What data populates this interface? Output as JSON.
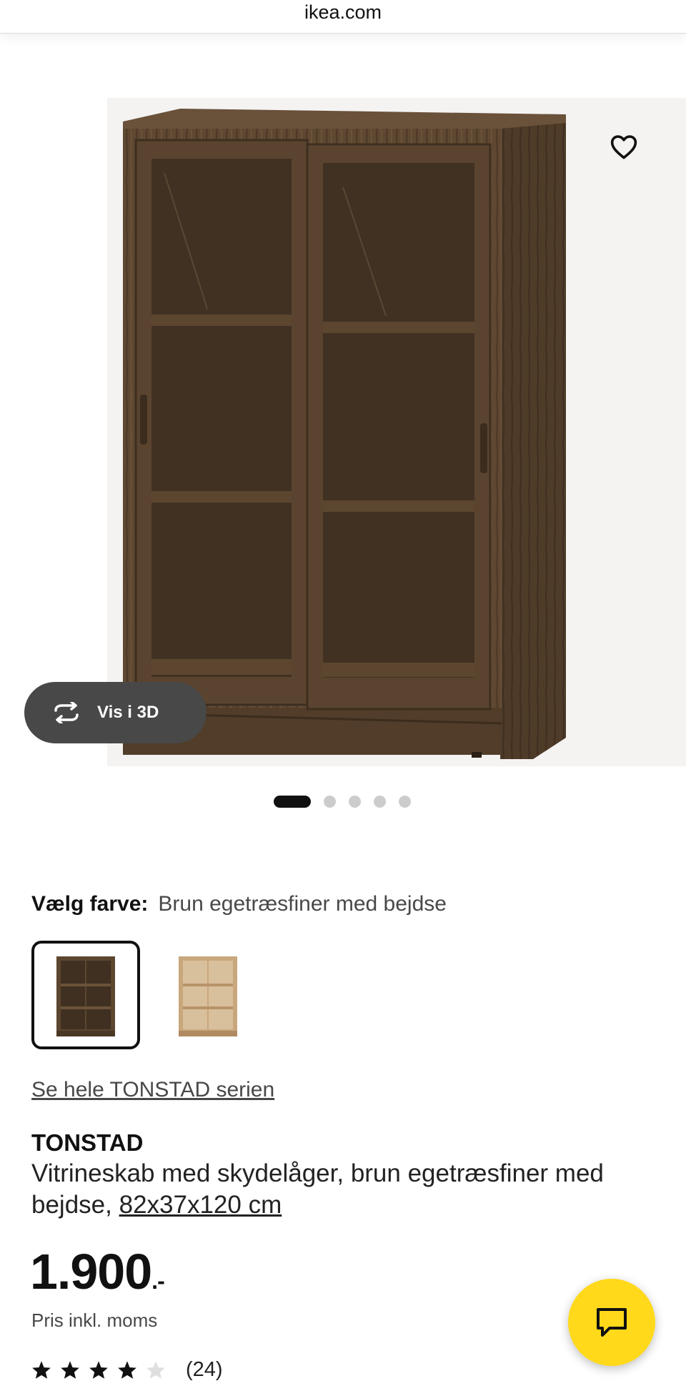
{
  "browser": {
    "url": "ikea.com"
  },
  "gallery": {
    "view3d_label": "Vis i 3D",
    "image_count": 5,
    "active_index": 0
  },
  "color": {
    "label": "Vælg farve:",
    "value": "Brun egetræsfiner med bejdse",
    "options": [
      "brown-oak-veneer-stained",
      "oak-veneer"
    ]
  },
  "series_link": "Se hele TONSTAD serien",
  "product": {
    "name": "TONSTAD",
    "description": "Vitrineskab med skydelåger, brun egetræsfiner med bejdse,",
    "dimensions": "82x37x120 cm"
  },
  "price": {
    "amount": "1.900",
    "suffix": ".-",
    "note": "Pris inkl. moms"
  },
  "rating": {
    "stars": 4,
    "max": 5,
    "count_label": "(24)"
  },
  "colors": {
    "chat_button": "#ffd91a",
    "view3d_button": "#484848",
    "wood_dark": "#5c4630",
    "wood_light": "#c9a77c"
  }
}
